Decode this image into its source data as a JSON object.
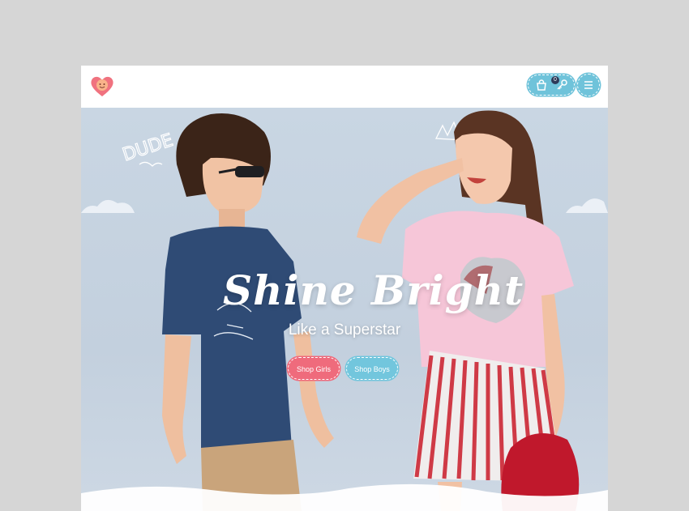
{
  "header": {
    "logo_icon": "heart-smiley-icon",
    "cart_count": "0",
    "cart_icon": "shopping-bag-icon",
    "account_icon": "key-icon",
    "menu_icon": "hamburger-menu-icon"
  },
  "hero": {
    "title": "Shine Bright",
    "subtitle": "Like a Superstar",
    "buttons": {
      "girls": "Shop Girls",
      "boys": "Shop Boys"
    },
    "doodles": [
      "DUDE"
    ]
  },
  "colors": {
    "accent_blue": "#6fc3da",
    "accent_pink": "#ef6b7c",
    "logo_pink": "#f0727f"
  }
}
